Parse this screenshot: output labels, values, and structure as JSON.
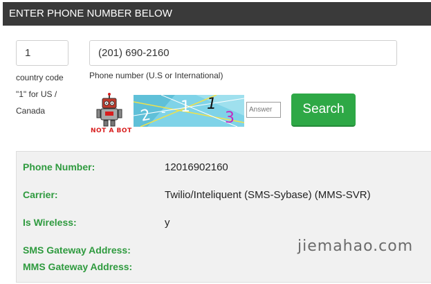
{
  "header": {
    "title": "ENTER PHONE NUMBER BELOW"
  },
  "form": {
    "country_code_value": "1",
    "country_code_help": [
      "country code",
      "\"1\" for US /",
      "Canada"
    ],
    "phone_value": "(201) 690-2160",
    "phone_help": "Phone number (U.S or International)",
    "robot_caption": "NOT A BOT",
    "captcha_text": "2-1 1 3",
    "answer_placeholder": "Answer",
    "search_label": "Search"
  },
  "results": {
    "phone_number": {
      "label": "Phone Number:",
      "value": "12016902160"
    },
    "carrier": {
      "label": "Carrier:",
      "value": "Twilio/Inteliquent (SMS-Sybase) (MMS-SVR)"
    },
    "is_wireless": {
      "label": "Is Wireless:",
      "value": "y"
    },
    "sms_gateway": {
      "label": "SMS Gateway Address:",
      "value": ""
    },
    "mms_gateway": {
      "label": "MMS Gateway Address:",
      "value": ""
    }
  },
  "watermark": "jiemahao.com",
  "colors": {
    "header_bg": "#3a3a3a",
    "accent_green": "#2ea846",
    "label_green": "#2e9a3e"
  }
}
